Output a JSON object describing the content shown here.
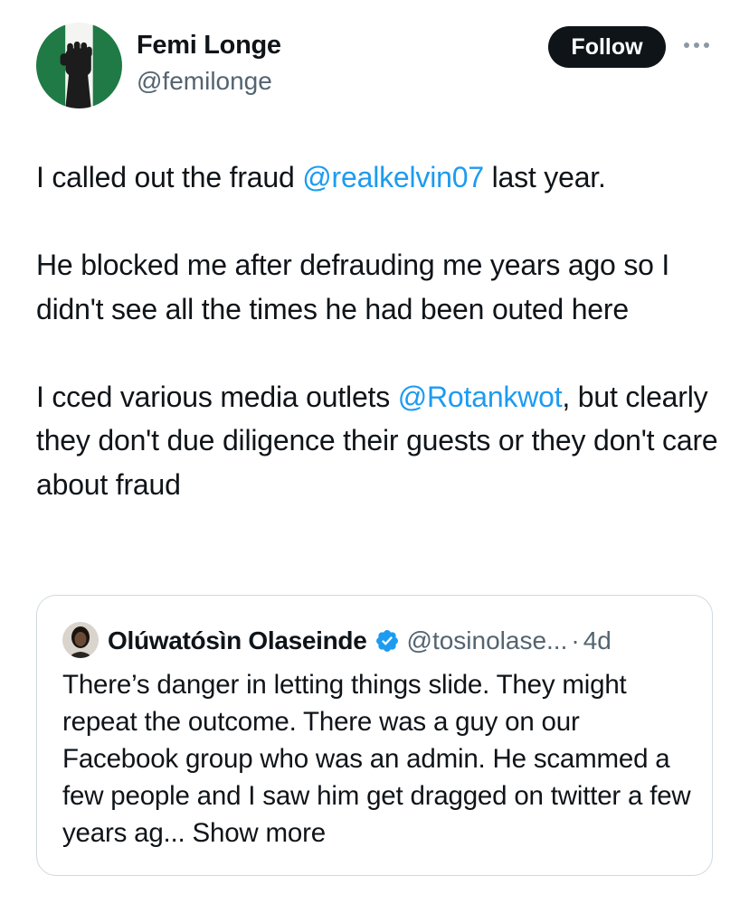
{
  "author": {
    "name": "Femi Longe",
    "handle": "@femilonge"
  },
  "actions": {
    "follow_label": "Follow",
    "more_icon": "more-horizontal-icon"
  },
  "tweet": {
    "p1_before": "I called out the fraud ",
    "p1_mention": "@realkelvin07",
    "p1_after": " last year.",
    "p2": "He blocked me after defrauding me years ago so I didn't see all the times he had been outed here",
    "p3_before": "I cced various media outlets ",
    "p3_mention": "@Rotankwot",
    "p3_after": ", but clearly they don't due diligence their guests or they don't care about fraud"
  },
  "quote": {
    "name": "Olúwatósìn Olaseinde",
    "verified_icon": "verified-badge-icon",
    "handle": "@tosinolase...",
    "separator": "·",
    "time": "4d",
    "text": "There’s danger in letting things slide. They might repeat the outcome. There was a guy on our Facebook group who was an admin. He scammed a few people and I saw him get dragged on twitter a few years ag...",
    "show_more": " Show more"
  },
  "colors": {
    "link": "#1d9bf0",
    "text": "#0f1419",
    "secondary": "#536471",
    "border": "#cfd9de",
    "verified": "#1d9bf0",
    "flag_green": "#008751"
  }
}
